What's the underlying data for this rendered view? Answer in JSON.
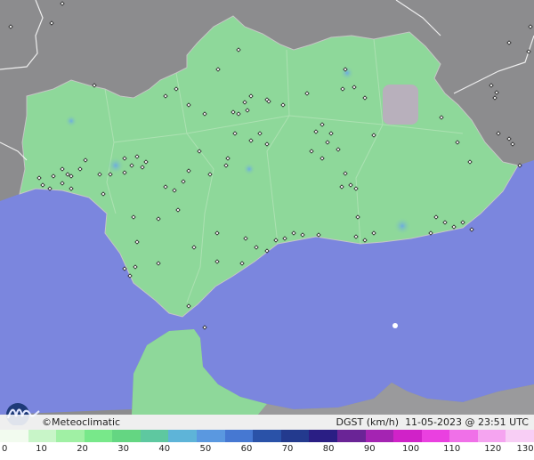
{
  "footer": {
    "copyright_symbol": "©",
    "brand": "Meteoclimatic",
    "variable": "DGST (km/h)",
    "timestamp": "11-05-2023 @ 23:51 UTC"
  },
  "scale": {
    "labels": [
      "0",
      "10",
      "20",
      "30",
      "40",
      "50",
      "60",
      "70",
      "80",
      "90",
      "100",
      "110",
      "120",
      "130"
    ],
    "colors": [
      "#f2fbef",
      "#c8f5c8",
      "#a0f0a4",
      "#78e88a",
      "#64d682",
      "#5ec8a0",
      "#5eb4d8",
      "#5a98e0",
      "#4678d2",
      "#2a52a8",
      "#233a8e",
      "#2a1e84",
      "#6a2496",
      "#a424b2",
      "#d022c8",
      "#ea40e0",
      "#f070e8",
      "#f5a4f0",
      "#f8cef5"
    ]
  },
  "colors": {
    "sea": "#7b86de",
    "land_outside": "#8e8e90",
    "region": "#8ed89a",
    "station": "#ffffff",
    "mountain": "#b8b0bc"
  }
}
